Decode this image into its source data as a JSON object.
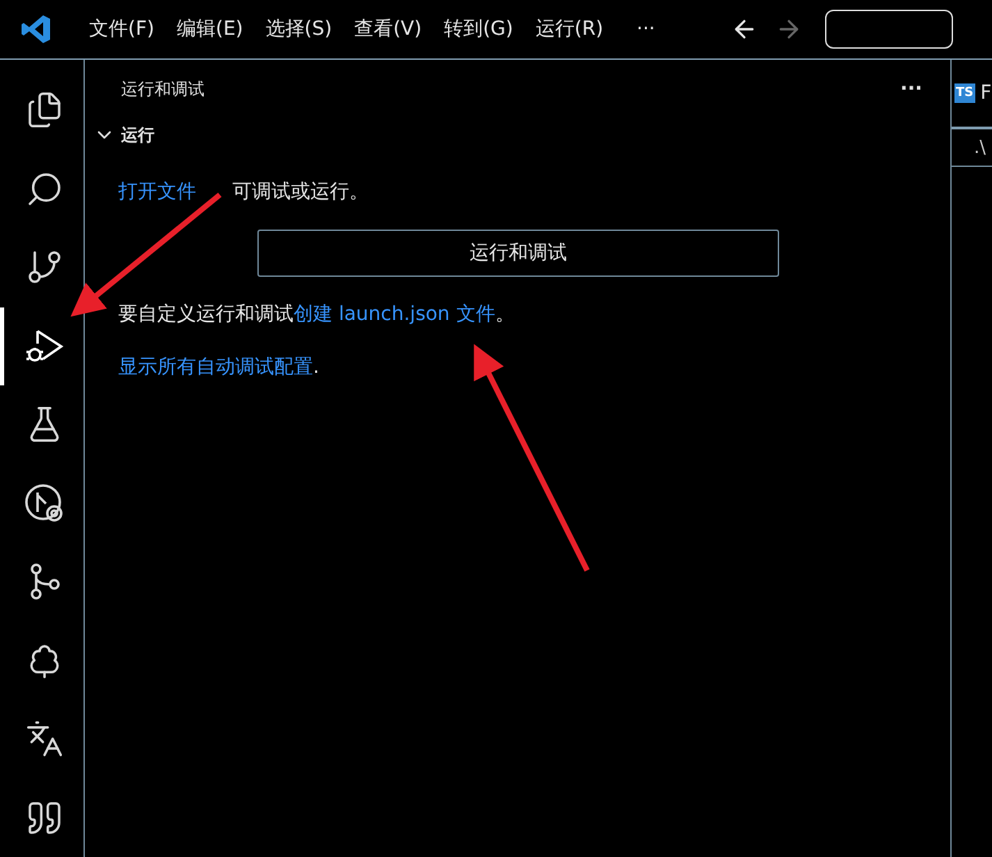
{
  "menu": [
    "文件(F)",
    "编辑(E)",
    "选择(S)",
    "查看(V)",
    "转到(G)",
    "运行(R)"
  ],
  "more_menu": "···",
  "nav": [
    {
      "kind": "back",
      "disabled": false
    },
    {
      "kind": "forward",
      "disabled": true
    }
  ],
  "activity_bar": [
    {
      "kind": "files",
      "selected": false
    },
    {
      "kind": "search",
      "selected": false
    },
    {
      "kind": "source-control",
      "selected": false
    },
    {
      "kind": "run",
      "selected": true
    },
    {
      "kind": "testing",
      "selected": false
    },
    {
      "kind": "remote",
      "selected": false
    },
    {
      "kind": "graph",
      "selected": false
    },
    {
      "kind": "tree",
      "selected": false
    },
    {
      "kind": "translate",
      "selected": false
    },
    {
      "kind": "quote",
      "selected": false
    }
  ],
  "panel": {
    "title": "运行和调试",
    "more": "···",
    "section": {
      "title": "运行",
      "expanded": true,
      "paragraphs": [
        {
          "parts": [
            {
              "kind": "link",
              "text": "打开文件"
            },
            {
              "kind": "gap",
              "text": "可调试或运行。"
            }
          ]
        },
        {
          "kind": "button",
          "text": "运行和调试"
        },
        {
          "parts": [
            {
              "kind": "text",
              "text": "要自定义运行和调试"
            },
            {
              "kind": "link",
              "text": "创建 launch.json 文件"
            },
            {
              "kind": "text",
              "text": "。"
            }
          ]
        },
        {
          "parts": [
            {
              "kind": "link",
              "text": "显示所有自动调试配置"
            },
            {
              "kind": "text",
              "text": "."
            }
          ]
        }
      ]
    }
  },
  "editor": {
    "tab": {
      "icon": "TS",
      "label": "F"
    },
    "breadcrumb": ".\\"
  }
}
